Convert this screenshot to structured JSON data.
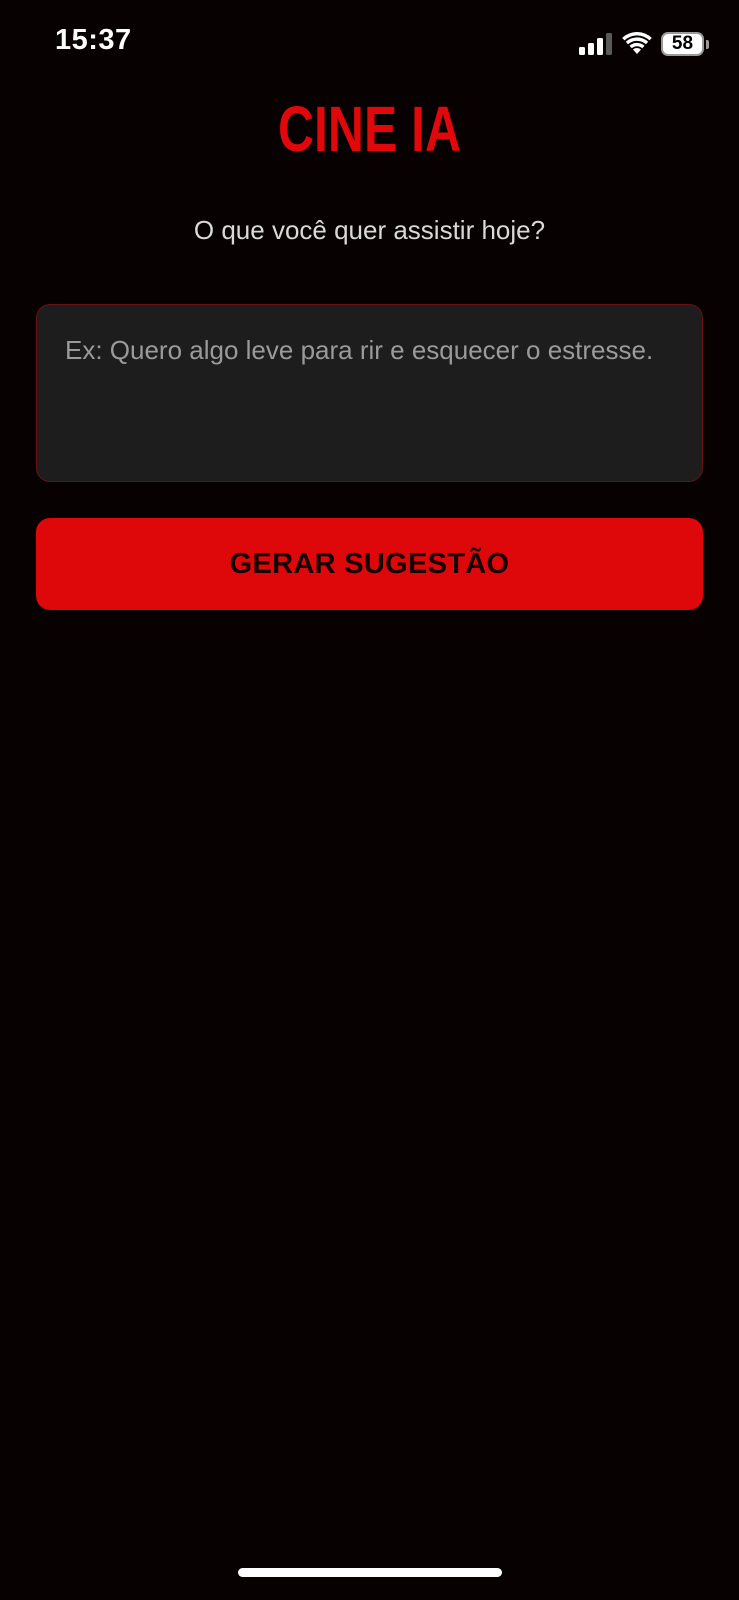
{
  "status_bar": {
    "time": "15:37",
    "battery_level": "58",
    "icons": [
      "signal-icon",
      "wifi-icon",
      "battery-icon"
    ]
  },
  "app": {
    "title": "CINE IA",
    "subtitle": "O que você quer assistir hoje?"
  },
  "prompt": {
    "value": "",
    "placeholder": "Ex: Quero algo leve para rir e esquecer o estresse."
  },
  "actions": {
    "generate_label": "GERAR SUGESTÃO"
  },
  "colors": {
    "background": "#070102",
    "accent": "#de0709",
    "input_background": "#1d1d1d",
    "input_border": "#6b1114",
    "button_text": "#160001",
    "placeholder": "#9a9a9a"
  }
}
